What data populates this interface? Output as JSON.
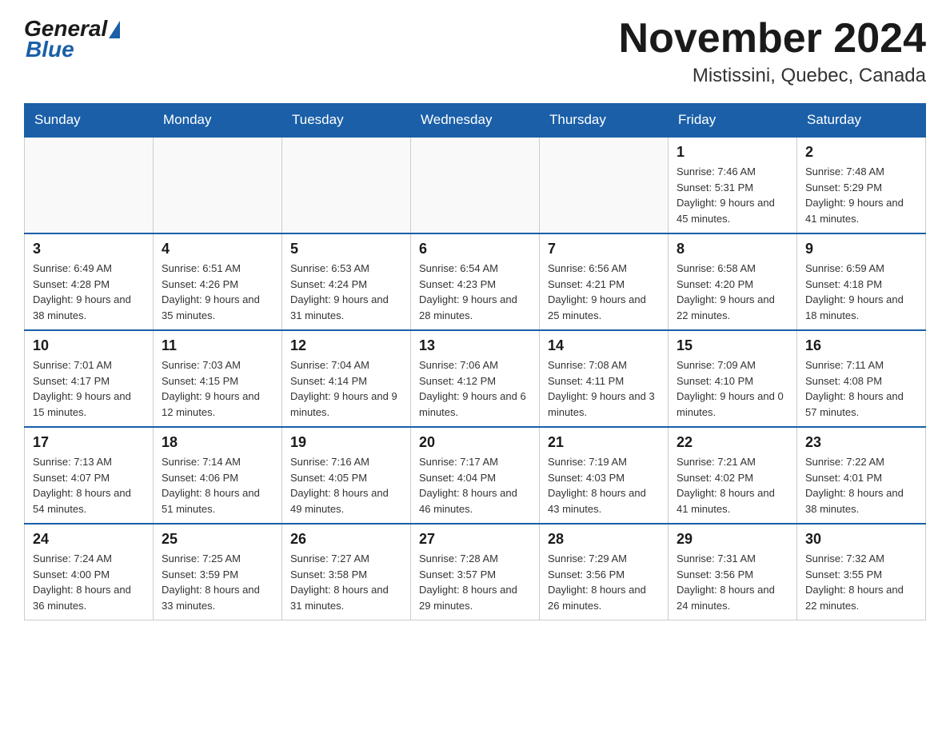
{
  "header": {
    "logo": {
      "general_text": "General",
      "blue_text": "Blue"
    },
    "month_title": "November 2024",
    "location": "Mistissini, Quebec, Canada"
  },
  "weekdays": [
    "Sunday",
    "Monday",
    "Tuesday",
    "Wednesday",
    "Thursday",
    "Friday",
    "Saturday"
  ],
  "weeks": [
    {
      "days": [
        {
          "number": "",
          "info": ""
        },
        {
          "number": "",
          "info": ""
        },
        {
          "number": "",
          "info": ""
        },
        {
          "number": "",
          "info": ""
        },
        {
          "number": "",
          "info": ""
        },
        {
          "number": "1",
          "info": "Sunrise: 7:46 AM\nSunset: 5:31 PM\nDaylight: 9 hours and 45 minutes."
        },
        {
          "number": "2",
          "info": "Sunrise: 7:48 AM\nSunset: 5:29 PM\nDaylight: 9 hours and 41 minutes."
        }
      ]
    },
    {
      "days": [
        {
          "number": "3",
          "info": "Sunrise: 6:49 AM\nSunset: 4:28 PM\nDaylight: 9 hours and 38 minutes."
        },
        {
          "number": "4",
          "info": "Sunrise: 6:51 AM\nSunset: 4:26 PM\nDaylight: 9 hours and 35 minutes."
        },
        {
          "number": "5",
          "info": "Sunrise: 6:53 AM\nSunset: 4:24 PM\nDaylight: 9 hours and 31 minutes."
        },
        {
          "number": "6",
          "info": "Sunrise: 6:54 AM\nSunset: 4:23 PM\nDaylight: 9 hours and 28 minutes."
        },
        {
          "number": "7",
          "info": "Sunrise: 6:56 AM\nSunset: 4:21 PM\nDaylight: 9 hours and 25 minutes."
        },
        {
          "number": "8",
          "info": "Sunrise: 6:58 AM\nSunset: 4:20 PM\nDaylight: 9 hours and 22 minutes."
        },
        {
          "number": "9",
          "info": "Sunrise: 6:59 AM\nSunset: 4:18 PM\nDaylight: 9 hours and 18 minutes."
        }
      ]
    },
    {
      "days": [
        {
          "number": "10",
          "info": "Sunrise: 7:01 AM\nSunset: 4:17 PM\nDaylight: 9 hours and 15 minutes."
        },
        {
          "number": "11",
          "info": "Sunrise: 7:03 AM\nSunset: 4:15 PM\nDaylight: 9 hours and 12 minutes."
        },
        {
          "number": "12",
          "info": "Sunrise: 7:04 AM\nSunset: 4:14 PM\nDaylight: 9 hours and 9 minutes."
        },
        {
          "number": "13",
          "info": "Sunrise: 7:06 AM\nSunset: 4:12 PM\nDaylight: 9 hours and 6 minutes."
        },
        {
          "number": "14",
          "info": "Sunrise: 7:08 AM\nSunset: 4:11 PM\nDaylight: 9 hours and 3 minutes."
        },
        {
          "number": "15",
          "info": "Sunrise: 7:09 AM\nSunset: 4:10 PM\nDaylight: 9 hours and 0 minutes."
        },
        {
          "number": "16",
          "info": "Sunrise: 7:11 AM\nSunset: 4:08 PM\nDaylight: 8 hours and 57 minutes."
        }
      ]
    },
    {
      "days": [
        {
          "number": "17",
          "info": "Sunrise: 7:13 AM\nSunset: 4:07 PM\nDaylight: 8 hours and 54 minutes."
        },
        {
          "number": "18",
          "info": "Sunrise: 7:14 AM\nSunset: 4:06 PM\nDaylight: 8 hours and 51 minutes."
        },
        {
          "number": "19",
          "info": "Sunrise: 7:16 AM\nSunset: 4:05 PM\nDaylight: 8 hours and 49 minutes."
        },
        {
          "number": "20",
          "info": "Sunrise: 7:17 AM\nSunset: 4:04 PM\nDaylight: 8 hours and 46 minutes."
        },
        {
          "number": "21",
          "info": "Sunrise: 7:19 AM\nSunset: 4:03 PM\nDaylight: 8 hours and 43 minutes."
        },
        {
          "number": "22",
          "info": "Sunrise: 7:21 AM\nSunset: 4:02 PM\nDaylight: 8 hours and 41 minutes."
        },
        {
          "number": "23",
          "info": "Sunrise: 7:22 AM\nSunset: 4:01 PM\nDaylight: 8 hours and 38 minutes."
        }
      ]
    },
    {
      "days": [
        {
          "number": "24",
          "info": "Sunrise: 7:24 AM\nSunset: 4:00 PM\nDaylight: 8 hours and 36 minutes."
        },
        {
          "number": "25",
          "info": "Sunrise: 7:25 AM\nSunset: 3:59 PM\nDaylight: 8 hours and 33 minutes."
        },
        {
          "number": "26",
          "info": "Sunrise: 7:27 AM\nSunset: 3:58 PM\nDaylight: 8 hours and 31 minutes."
        },
        {
          "number": "27",
          "info": "Sunrise: 7:28 AM\nSunset: 3:57 PM\nDaylight: 8 hours and 29 minutes."
        },
        {
          "number": "28",
          "info": "Sunrise: 7:29 AM\nSunset: 3:56 PM\nDaylight: 8 hours and 26 minutes."
        },
        {
          "number": "29",
          "info": "Sunrise: 7:31 AM\nSunset: 3:56 PM\nDaylight: 8 hours and 24 minutes."
        },
        {
          "number": "30",
          "info": "Sunrise: 7:32 AM\nSunset: 3:55 PM\nDaylight: 8 hours and 22 minutes."
        }
      ]
    }
  ]
}
